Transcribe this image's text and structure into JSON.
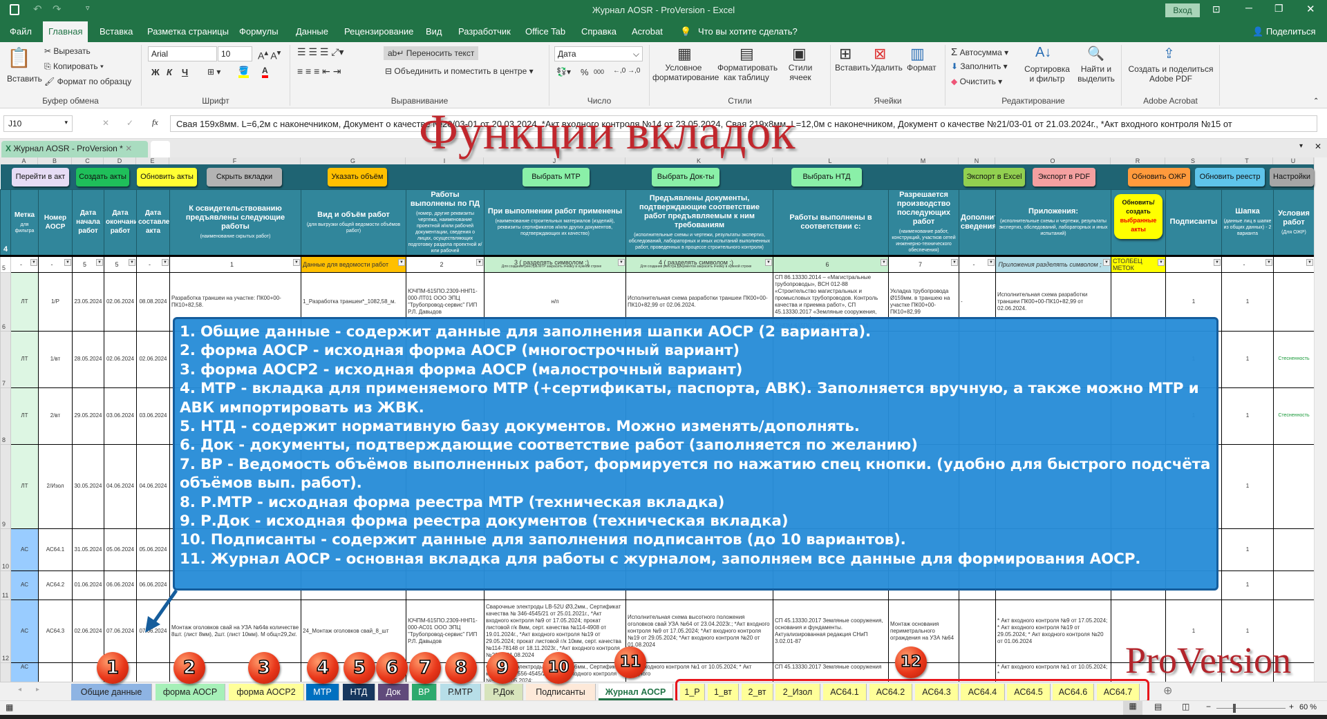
{
  "window": {
    "title": "Журнал AOSR - ProVersion  -  Excel",
    "login_button": "Вход"
  },
  "menu": {
    "tabs": [
      "Файл",
      "Главная",
      "Вставка",
      "Разметка страницы",
      "Формулы",
      "Данные",
      "Рецензирование",
      "Вид",
      "Разработчик",
      "Office Tab",
      "Справка",
      "Acrobat"
    ],
    "active": "Главная",
    "tell_me": "Что вы хотите сделать?",
    "share": "Поделиться"
  },
  "ribbon": {
    "clipboard": {
      "label": "Буфер обмена",
      "paste": "Вставить",
      "cut": "Вырезать",
      "copy": "Копировать",
      "format_painter": "Формат по образцу"
    },
    "font": {
      "label": "Шрифт",
      "font_name": "Arial",
      "font_size": "10",
      "bold": "Ж",
      "italic": "К",
      "underline": "Ч"
    },
    "alignment": {
      "label": "Выравнивание",
      "wrap_text": "Переносить текст",
      "merge_center": "Объединить и поместить в центре"
    },
    "number": {
      "label": "Число",
      "format": "Дата",
      "percent": "%",
      "thousands": "000"
    },
    "styles": {
      "label": "Стили",
      "conditional": "Условное форматирование",
      "as_table": "Форматировать как таблицу",
      "cell_styles": "Стили ячеек"
    },
    "cells": {
      "label": "Ячейки",
      "insert": "Вставить",
      "delete": "Удалить",
      "format": "Формат"
    },
    "editing": {
      "label": "Редактирование",
      "autosum": "Автосумма",
      "fill": "Заполнить",
      "clear": "Очистить",
      "sort_filter": "Сортировка и фильтр",
      "find_select": "Найти и выделить"
    },
    "acrobat": {
      "label": "Adobe Acrobat",
      "create_share": "Создать и поделиться Adobe PDF"
    }
  },
  "formula_bar": {
    "cell_ref": "J10",
    "formula": "Свая 159x8мм. L=6,2м с наконечником, Документ о качестве №20/03-01 от 20.03.2024, *Акт входного контроля №14 от 23.05.2024, Свая 219x8мм. L=12,0м с наконечником, Документ о качестве №21/03-01 от 21.03.2024г., *Акт входного контроля №15 от"
  },
  "workbook_tab": {
    "name": "Журнал AOSR - ProVersion *"
  },
  "overlay": {
    "title": "Функции вкладок",
    "brand": "ProVersion"
  },
  "columns": [
    "A",
    "B",
    "C",
    "D",
    "E",
    "F",
    "G",
    "I",
    "J",
    "K",
    "L",
    "M",
    "N",
    "O",
    "R",
    "S",
    "T",
    "U"
  ],
  "sheet_buttons": [
    {
      "label": "Перейти в акт",
      "color": "#e6dcf5"
    },
    {
      "label": "Создать акты",
      "color": "#1fbf5a"
    },
    {
      "label": "Обновить акты",
      "color": "#ffff33"
    },
    {
      "label": "Скрыть вкладки",
      "color": "#b3b3b3"
    },
    {
      "label": "Указать объём",
      "color": "#ffc000"
    },
    {
      "label": "Выбрать МТР",
      "color": "#8af0a8"
    },
    {
      "label": "Выбрать Док-ты",
      "color": "#8af0a8"
    },
    {
      "label": "Выбрать НТД",
      "color": "#8af0a8"
    },
    {
      "label": "Экспорт в Excel",
      "color": "#92d050"
    },
    {
      "label": "Экспорт в PDF",
      "color": "#f4a0a0"
    },
    {
      "label": "Обновить ОЖР",
      "color": "#ff9a3c"
    },
    {
      "label": "Обновить реестр",
      "color": "#5fc4ea"
    },
    {
      "label": "Настройки",
      "color": "#a6a6a6"
    }
  ],
  "headers": [
    {
      "t": "Метка",
      "s": "для фильтра"
    },
    {
      "t": "Номер АОСР",
      "s": ""
    },
    {
      "t": "Дата начала работ",
      "s": ""
    },
    {
      "t": "Дата окончания работ",
      "s": ""
    },
    {
      "t": "Дата составления акта",
      "s": ""
    },
    {
      "t": "К освидетельствованию предъявлены следующие работы",
      "s": "(наименование скрытых работ)"
    },
    {
      "t": "Вид и объём работ",
      "s": "(для выгрузки общей ведомости объёмов работ)"
    },
    {
      "t": "Работы выполнены по ПД",
      "s": "(номер, другие реквизиты чертежа, наименование проектной и/или рабочей документации, сведения о лицах, осуществляющих подготовку раздела проектной и/или рабочей"
    },
    {
      "t": "При выполнении работ применены",
      "s": "(наименование строительных материалов (изделий), реквизиты сертификатов и/или других документов, подтверждающих их качество)"
    },
    {
      "t": "Предъявлены документы, подтверждающие соответствие работ предъявляемым к ним требованиям",
      "s": "(исполнительные схемы и чертежи, результаты экспертиз, обследований, лабораторных и иных испытаний выполненных работ, проведенных в процессе строительного контроля)"
    },
    {
      "t": "Работы выполнены в соответствии с:",
      "s": ""
    },
    {
      "t": "Разрешается производство последующих работ",
      "s": "(наименование работ, конструкций, участков сетей инженерно-технического обеспечения)"
    },
    {
      "t": "Дополнительные сведения",
      "s": ""
    },
    {
      "t": "Приложения:",
      "s": "(исполнительные схемы и чертежи, результаты экспертиз, обследований, лабораторных и иных испытаний)"
    },
    {
      "t": "",
      "s": ""
    },
    {
      "t": "Подписанты",
      "s": ""
    },
    {
      "t": "Шапка",
      "s": "(данные лиц в шапке из общих данных) - 2 варианта"
    },
    {
      "t": "Условия работ",
      "s": "(Для ОЖР)"
    }
  ],
  "update_button": {
    "line1": "Обновить/ создать",
    "line2": "выбранные акты"
  },
  "filter_row": [
    "-",
    "-",
    "5",
    "5",
    "-",
    "1",
    "Данные для ведомости работ",
    "2",
    "3 ( разделять символом ;)",
    "4 ( разделять символом ;)",
    "6",
    "7",
    "-",
    "Приложения разделять символом ;",
    "СТОЛБЕЦ МЕТОК",
    "",
    "-",
    ""
  ],
  "filter_notes": {
    "j": "Для создания реестра МТР закрасить ячейку в нужной строке",
    "k": "Для создания реестра документов закрасить ячейку в нужной строке"
  },
  "rows": [
    {
      "rn": "6",
      "cells": [
        "ЛТ",
        "1/Р",
        "23.05.2024",
        "02.06.2024",
        "08.08.2024",
        "Разработка траншеи на участке: ПК00+00-ПК10+82,58.",
        "1_Разработка траншеи*_1082,58_м.",
        "ЮЧПМ-615ПО.2309-ННП1-000-ЛТ01 ООО ЭПЦ \"Трубопровод-сервис\" ГИП Р.Л. Давыдов",
        "н/п",
        "Исполнительная схема разработки траншеи ПК00+00-ПК10+82,99 от 02.06.2024.",
        "СП 86.13330.2014 – «Магистральные трубопроводы», ВСН 012-88 «Строительство магистральных и промысловых трубопроводов. Контроль качества и приемка работ», СП 45.13330.2017 «Земляные сооружения, основания и фундаменты», ЮЧПМ-615ПО.2309-ННП1-000-ЛТ01",
        "Укладка трубопровода Ø159мм. в траншею на участке ПК00+00-ПК10+82,99",
        "-",
        "Исполнительная схема разработки траншеи ПК00+00-ПК10+82,99 от 02.06.2024.",
        "",
        "1",
        "1",
        ""
      ]
    },
    {
      "rn": "7",
      "cells": [
        "ЛТ",
        "1/вт",
        "28.05.2024",
        "02.06.2024",
        "02.06.2024",
        "",
        "",
        "",
        "",
        "",
        "",
        "",
        "",
        "",
        "",
        "1",
        "1",
        "Стесненность"
      ]
    },
    {
      "rn": "8",
      "cells": [
        "ЛТ",
        "2/вт",
        "29.05.2024",
        "03.06.2024",
        "03.06.2024",
        "",
        "",
        "",
        "",
        "",
        "",
        "",
        "",
        "",
        "",
        "1",
        "1",
        "Стесненность"
      ]
    },
    {
      "rn": "9",
      "cells": [
        "ЛТ",
        "2/Изол",
        "30.05.2024",
        "04.06.2024",
        "04.06.2024",
        "",
        "",
        "",
        "",
        "",
        "",
        "",
        "",
        "",
        "",
        "",
        "1",
        ""
      ]
    },
    {
      "rn": "10",
      "cells": [
        "АС",
        "АС64.1",
        "31.05.2024",
        "05.06.2024",
        "05.06.2024",
        "",
        "",
        "",
        "",
        "",
        "",
        "",
        "",
        "",
        "",
        "",
        "1",
        ""
      ]
    },
    {
      "rn": "11",
      "cells": [
        "АС",
        "АС64.2",
        "01.06.2024",
        "06.06.2024",
        "06.06.2024",
        "",
        "",
        "",
        "",
        "",
        "",
        "",
        "",
        "",
        "",
        "",
        "1",
        ""
      ]
    },
    {
      "rn": "12",
      "cells": [
        "АС",
        "АС64.3",
        "02.06.2024",
        "07.06.2024",
        "07.06.2024",
        "Монтаж оголовков свай на УЗА №64в количестве 8шт. (лист 8мм), 2шт. (лист 10мм). М общ=29,2кг.",
        "24_Монтаж оголовков свай_8_шт",
        "ЮЧПМ-615ПО.2309-ННП1-000-АС01 ООО ЭПЦ \"Трубопровод-сервис\" ГИП Р.Л. Давыдов",
        "Сварочные электроды LB-52U Ø3,2мм., Сертификат качества № 346-4545/21 от 25.01.2021г., *Акт входного контроля №9 от 17.05.2024; прокат листовой г/к 8мм, серт. качества №114-4908 от 19.01.2024г., *Акт входного контроля №19 от 29.05.2024; прокат листовой г/к 10мм, серт. качества №114-78148 от 18.11.2023г., *Акт входного контроля №20 от 01.08.2024",
        "Исполнительная схема высотного положения оголовков свай УЗА №64 от 23.04.2023г.; *Акт входного контроля №9 от 17.05.2024; *Акт входного контроля №19 от 29.05.2024; *Акт входного контроля №20 от 01.08.2024",
        "СП 45.13330.2017 Земляные сооружения, основания и фундаменты. Актуализированная редакция СНиП 3.02.01-87",
        "Монтаж основания периметрального ограждения на УЗА №64",
        "",
        "* Акт входного контроля №9 от 17.05.2024; * Акт входного контроля №19 от 29.05.2024; * Акт входного контроля №20 от 01.06.2024",
        "",
        "1",
        "1",
        ""
      ]
    },
    {
      "rn": "13",
      "cells": [
        "АС",
        "",
        "",
        "",
        "",
        "",
        "",
        "",
        "Сварочные электроды LB-52U Ø2,6мм., Сертификат качества № 556-4545/21 ... *Акт входного контроля №9 от 17.05.2024;",
        "* Акт входного контроля №1 от 10.05.2024; * Акт входного",
        "СП 45.13330.2017 Земляные сооружения",
        "",
        "",
        "* Акт входного контроля №1 от 10.05.2024; *",
        "",
        "",
        "",
        ""
      ]
    }
  ],
  "callout": {
    "items": [
      "1. Общие данные - содержит данные для заполнения шапки АОСР (2 варианта).",
      "2. форма АОСР - исходная форма АОСР (многострочный вариант)",
      "3. форма АОСР2 - исходная форма АОСР (малострочный вариант)",
      "4. МТР - вкладка для применяемого МТР (+сертификаты, паспорта, АВК). Заполняется вручную, а также можно МТР и АВК импортировать из ЖВК.",
      "5. НТД - содержит нормативную базу документов. Можно изменять/дополнять.",
      "6. Док - документы, подтверждающие соответствие работ (заполняется по желанию)",
      "7. ВР - Ведомость объёмов выполненных работ, формируется по нажатию спец кнопки. (удобно для быстрого подсчёта объёмов вып. работ).",
      "8. Р.МТР - исходная форма реестра МТР (техническая вкладка)",
      "9. Р.Док - исходная форма реестра документов (техническая вкладка)",
      "10. Подписанты - содержит данные для заполнения подписантов (до 10 вариантов).",
      "11. Журнал АОСР - основная вкладка для работы с журналом, заполняем все данные для формирования АОСР."
    ]
  },
  "markers": [
    "1",
    "2",
    "3",
    "4",
    "5",
    "6",
    "7",
    "8",
    "9",
    "10",
    "11",
    "12"
  ],
  "sheet_tabs": [
    {
      "label": "Общие данные",
      "color": "#8eb4e3"
    },
    {
      "label": "форма АОСР",
      "color": "#a6f0b8"
    },
    {
      "label": "форма АОСР2",
      "color": "#ffff99"
    },
    {
      "label": "МТР",
      "color": "#0070c0"
    },
    {
      "label": "НТД",
      "color": "#17375e"
    },
    {
      "label": "Док",
      "color": "#604a7b"
    },
    {
      "label": "ВР",
      "color": "#2eaa6e"
    },
    {
      "label": "Р.МТР",
      "color": "#b7dee8"
    },
    {
      "label": "Р.Док",
      "color": "#d7e4bc"
    },
    {
      "label": "Подписанты",
      "color": "#fde9d9"
    },
    {
      "label": "Журнал АОСР",
      "color": "#ffffff",
      "active": true
    },
    {
      "label": "1_Р",
      "color": "#ffff99"
    },
    {
      "label": "1_вт",
      "color": "#ffff99"
    },
    {
      "label": "2_вт",
      "color": "#ffff99"
    },
    {
      "label": "2_Изол",
      "color": "#ffff99"
    },
    {
      "label": "АС64.1",
      "color": "#ffff99"
    },
    {
      "label": "АС64.2",
      "color": "#ffff99"
    },
    {
      "label": "АС64.3",
      "color": "#ffff99"
    },
    {
      "label": "АС64.4",
      "color": "#ffff99"
    },
    {
      "label": "АС64.5",
      "color": "#ffff99"
    },
    {
      "label": "АС64.6",
      "color": "#ffff99"
    },
    {
      "label": "АС64.7",
      "color": "#ffff99"
    }
  ],
  "status": {
    "zoom": "60 %"
  }
}
